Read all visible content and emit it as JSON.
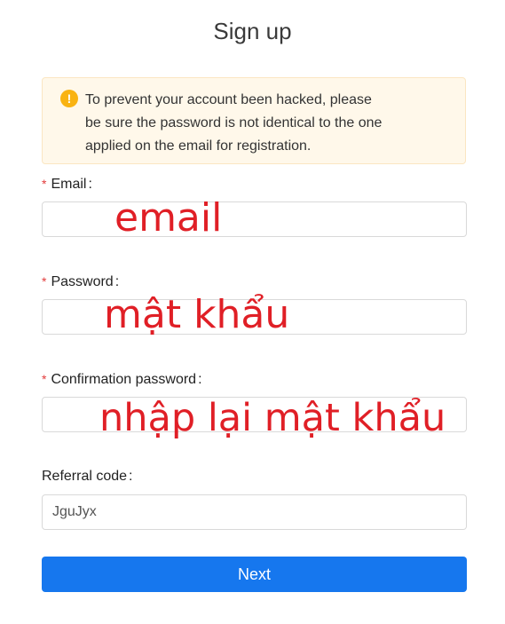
{
  "page": {
    "title": "Sign up"
  },
  "alert": {
    "icon": "warning-circle-icon",
    "line1": "To prevent your account been hacked, please",
    "line2": "be sure the password is not identical to the one",
    "line3": "applied on the email for registration."
  },
  "form": {
    "required_mark": "*",
    "email_label": "Email",
    "password_label": "Password",
    "confirm_label": "Confirmation password",
    "referral_label": "Referral code",
    "colon": ":",
    "email_value": "",
    "password_value": "",
    "confirm_value": "",
    "referral_value": "JguJyx",
    "next_label": "Next"
  },
  "annotations": {
    "email": "email",
    "password": "mật khẩu",
    "confirm": "nhập lại mật khẩu",
    "color": "#e01f26"
  },
  "colors": {
    "primary": "#1677ee",
    "warning": "#f9b312",
    "required": "#e23b3b"
  }
}
